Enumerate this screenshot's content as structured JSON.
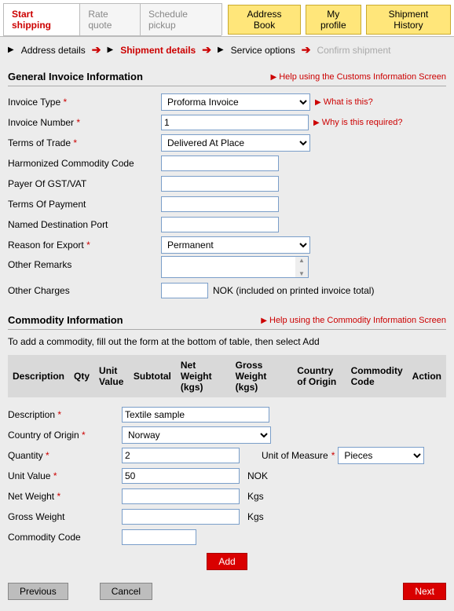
{
  "tabs": {
    "start_shipping": "Start shipping",
    "rate_quote": "Rate quote",
    "schedule_pickup": "Schedule pickup"
  },
  "yellow": {
    "address_book": "Address Book",
    "my_profile": "My profile",
    "shipment_history": "Shipment History"
  },
  "wizard": {
    "address": "Address details",
    "shipment": "Shipment details",
    "service": "Service options",
    "confirm": "Confirm shipment"
  },
  "general": {
    "title": "General Invoice Information",
    "help": "Help using the Customs Information Screen",
    "invoice_type_label": "Invoice Type",
    "invoice_type_value": "Proforma Invoice",
    "invoice_type_aside": "What is this?",
    "invoice_number_label": "Invoice Number",
    "invoice_number_value": "1",
    "invoice_number_aside": "Why is this required?",
    "terms_of_trade_label": "Terms of Trade",
    "terms_of_trade_value": "Delivered At Place",
    "hcc_label": "Harmonized Commodity Code",
    "hcc_value": "",
    "payer_label": "Payer Of GST/VAT",
    "payer_value": "",
    "top_label": "Terms Of Payment",
    "top_value": "",
    "port_label": "Named Destination Port",
    "port_value": "",
    "reason_label": "Reason for Export",
    "reason_value": "Permanent",
    "remarks_label": "Other Remarks",
    "remarks_value": "",
    "charges_label": "Other Charges",
    "charges_value": "",
    "charges_suffix": "NOK  (included on printed invoice total)"
  },
  "commodity": {
    "title": "Commodity Information",
    "help": "Help using the Commodity Information Screen",
    "instruct": "To add a commodity, fill out the form at the bottom of table, then select Add",
    "th": {
      "description": "Description",
      "qty": "Qty",
      "unit_value": "Unit Value",
      "subtotal": "Subtotal",
      "net_weight": "Net Weight (kgs)",
      "gross_weight": "Gross Weight (kgs)",
      "country": "Country of Origin",
      "code": "Commodity Code",
      "action": "Action"
    },
    "form": {
      "description_label": "Description",
      "description_value": "Textile sample",
      "country_label": "Country of Origin",
      "country_value": "Norway",
      "qty_label": "Quantity",
      "qty_value": "2",
      "uom_label": "Unit of Measure",
      "uom_value": "Pieces",
      "unit_value_label": "Unit Value",
      "unit_value_value": "50",
      "unit_value_suffix": "NOK",
      "net_weight_label": "Net Weight",
      "net_weight_value": "",
      "gross_weight_label": "Gross Weight",
      "gross_weight_value": "",
      "weight_suffix": "Kgs",
      "code_label": "Commodity Code",
      "code_value": ""
    },
    "add_button": "Add"
  },
  "bottom": {
    "previous": "Previous",
    "cancel": "Cancel",
    "next": "Next"
  }
}
